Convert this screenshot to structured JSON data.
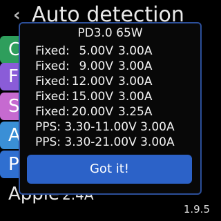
{
  "screen": {
    "title": "Auto detection",
    "bottom_label_main": "Apple",
    "bottom_label_sub": "2.4A",
    "version": "1.9.5",
    "menu_buttons": [
      {
        "label": "C",
        "color": "#2e9e5c"
      },
      {
        "label": "F",
        "color": "#8a5cd8"
      },
      {
        "label": "S",
        "color": "#c66ad0"
      },
      {
        "label": "A",
        "color": "#3a8fd6"
      },
      {
        "label": "P",
        "color": "#2f6fd0"
      }
    ]
  },
  "dialog": {
    "title": "PD3.0 65W",
    "fixed_rows": [
      {
        "label": "Fixed:",
        "voltage": "5.00V",
        "current": "3.00A"
      },
      {
        "label": "Fixed:",
        "voltage": "9.00V",
        "current": "3.00A"
      },
      {
        "label": "Fixed:",
        "voltage": "12.00V",
        "current": "3.00A"
      },
      {
        "label": "Fixed:",
        "voltage": "15.00V",
        "current": "3.00A"
      },
      {
        "label": "Fixed:",
        "voltage": "20.00V",
        "current": "3.25A"
      }
    ],
    "pps_rows": [
      {
        "text": "PPS: 3.30-11.00V 3.00A"
      },
      {
        "text": "PPS: 3.30-21.00V 3.00A"
      }
    ],
    "button_label": "Got it!"
  },
  "colors": {
    "dialog_border": "#2c4f9a",
    "button": "#2c62c8"
  }
}
